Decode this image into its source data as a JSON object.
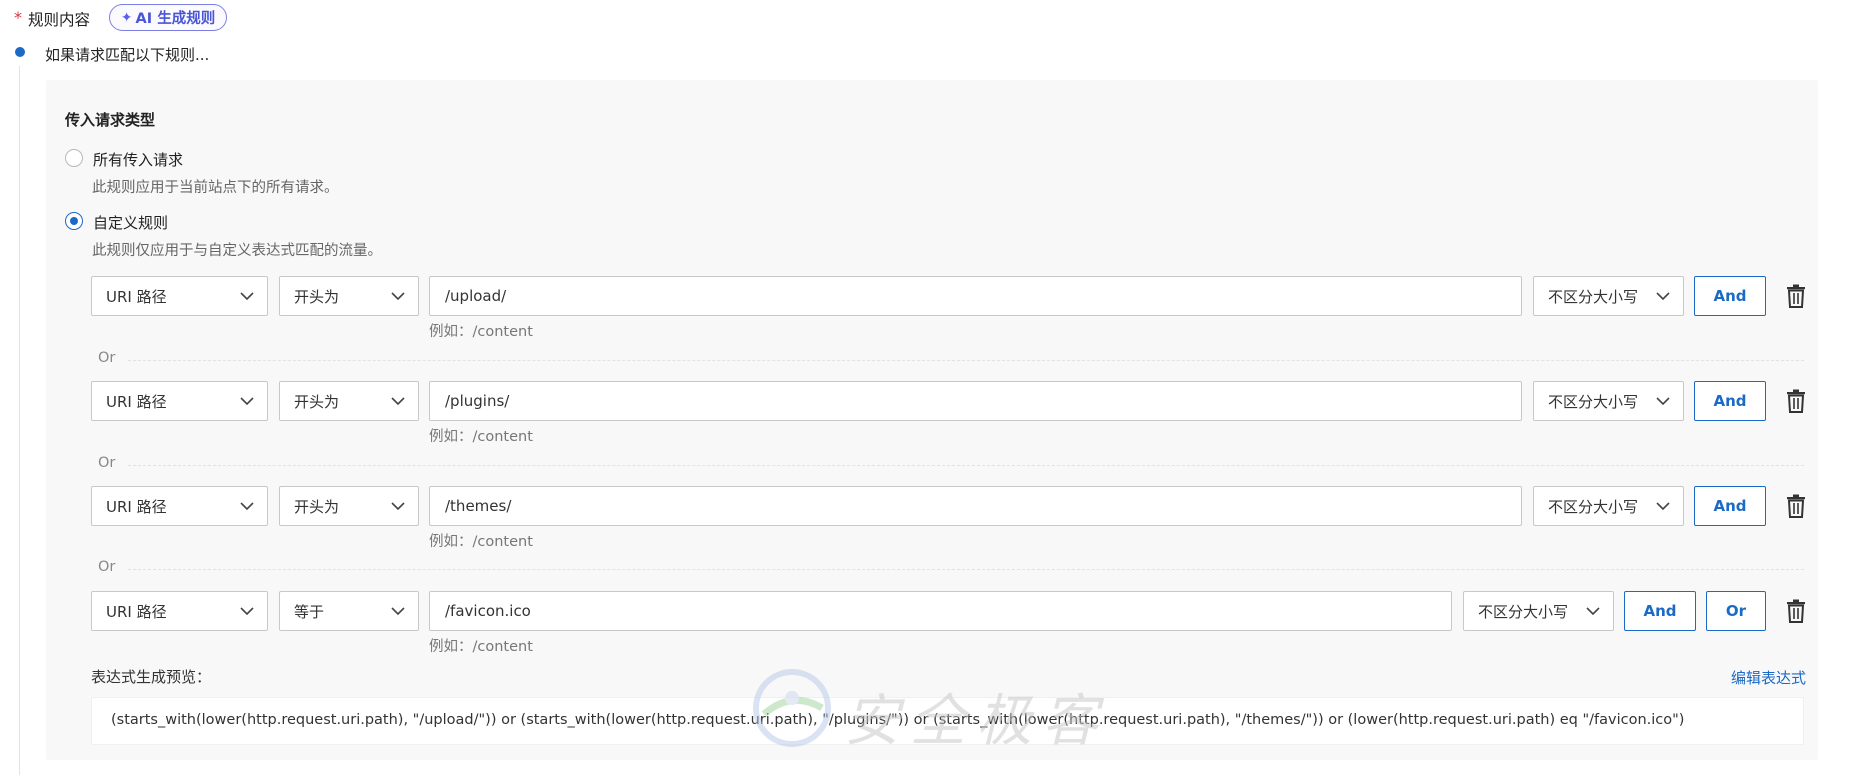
{
  "header": {
    "required_mark": "*",
    "section_label": "规则内容",
    "ai_button_label": "AI 生成规则"
  },
  "timeline": {
    "if_label": "如果请求匹配以下规则..."
  },
  "incoming_type": {
    "title": "传入请求类型",
    "options": [
      {
        "label": "所有传入请求",
        "desc": "此规则应用于当前站点下的所有请求。",
        "checked": false
      },
      {
        "label": "自定义规则",
        "desc": "此规则仅应用于与自定义表达式匹配的流量。",
        "checked": true
      }
    ]
  },
  "conditions": [
    {
      "field": "URI 路径",
      "operator": "开头为",
      "value": "/upload/",
      "hint": "例如：/content",
      "case": "不区分大小写",
      "and_label": "And",
      "or_label": ""
    },
    {
      "field": "URI 路径",
      "operator": "开头为",
      "value": "/plugins/",
      "hint": "例如：/content",
      "case": "不区分大小写",
      "and_label": "And",
      "or_label": ""
    },
    {
      "field": "URI 路径",
      "operator": "开头为",
      "value": "/themes/",
      "hint": "例如：/content",
      "case": "不区分大小写",
      "and_label": "And",
      "or_label": ""
    },
    {
      "field": "URI 路径",
      "operator": "等于",
      "value": "/favicon.ico",
      "hint": "例如：/content",
      "case": "不区分大小写",
      "and_label": "And",
      "or_label": "Or"
    }
  ],
  "separators": [
    "Or",
    "Or",
    "Or"
  ],
  "preview": {
    "label": "表达式生成预览：",
    "edit_link": "编辑表达式",
    "expression": "(starts_with(lower(http.request.uri.path), \"/upload/\")) or (starts_with(lower(http.request.uri.path), \"/plugins/\")) or (starts_with(lower(http.request.uri.path), \"/themes/\")) or (lower(http.request.uri.path) eq \"/favicon.ico\")"
  },
  "watermark": {
    "text": "安全极客"
  },
  "colors": {
    "accent": "#1b6ac6",
    "ai_purple": "#4a55d6",
    "required": "#e0333a"
  },
  "icons": [
    "sparkle-icon",
    "chevron-down-icon",
    "trash-icon",
    "watermark-logo-icon"
  ]
}
